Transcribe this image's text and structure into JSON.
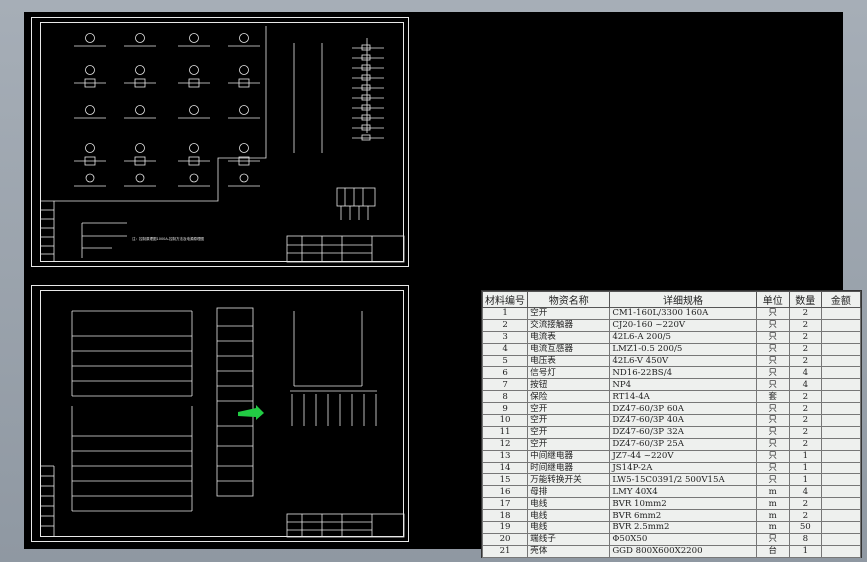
{
  "bom": {
    "headers": [
      "材料编号",
      "物资名称",
      "详细规格",
      "单位",
      "数量",
      "金额"
    ],
    "rows": [
      [
        "1",
        "空开",
        "CM1-160L/3300    160A",
        "只",
        "2",
        ""
      ],
      [
        "2",
        "交流接触器",
        "CJ20-160      ~220V",
        "只",
        "2",
        ""
      ],
      [
        "3",
        "电流表",
        "42L6-A       200/5",
        "只",
        "2",
        ""
      ],
      [
        "4",
        "电流互感器",
        "LMZ1-0.5   200/5",
        "只",
        "2",
        ""
      ],
      [
        "5",
        "电压表",
        "42L6-V       450V",
        "只",
        "2",
        ""
      ],
      [
        "6",
        "信号灯",
        "ND16-22BS/4",
        "只",
        "4",
        ""
      ],
      [
        "7",
        "按钮",
        "NP4",
        "只",
        "4",
        ""
      ],
      [
        "8",
        "保险",
        "RT14-4A",
        "套",
        "2",
        ""
      ],
      [
        "9",
        "空开",
        "DZ47-60/3P    60A",
        "只",
        "2",
        ""
      ],
      [
        "10",
        "空开",
        "DZ47-60/3P    40A",
        "只",
        "2",
        ""
      ],
      [
        "11",
        "空开",
        "DZ47-60/3P    32A",
        "只",
        "2",
        ""
      ],
      [
        "12",
        "空开",
        "DZ47-60/3P    25A",
        "只",
        "2",
        ""
      ],
      [
        "13",
        "中间继电器",
        "JZ7-44         ~220V",
        "只",
        "1",
        ""
      ],
      [
        "14",
        "时间继电器",
        "JS14P-2A",
        "只",
        "1",
        ""
      ],
      [
        "15",
        "万能转换开关",
        "LW5-15C0391/2  500V15A",
        "只",
        "1",
        ""
      ],
      [
        "16",
        "母排",
        "LMY 40X4",
        "m",
        "4",
        ""
      ],
      [
        "17",
        "电线",
        "BVR  10mm2",
        "m",
        "2",
        ""
      ],
      [
        "18",
        "电线",
        "BVR  6mm2",
        "m",
        "2",
        ""
      ],
      [
        "19",
        "电线",
        "BVR  2.5mm2",
        "m",
        "50",
        ""
      ],
      [
        "20",
        "端线子",
        "Φ50X50",
        "只",
        "8",
        ""
      ],
      [
        "21",
        "壳体",
        "GGD 800X600X2200",
        "台",
        "1",
        ""
      ]
    ]
  },
  "drawing": {
    "note": "注：控制原理图1000A-控制方法及电源原理图"
  },
  "colors": {
    "background": "#000000",
    "lines": "#e8e8e8",
    "accent": "#22cc44",
    "table_bg": "#eef0ee"
  }
}
